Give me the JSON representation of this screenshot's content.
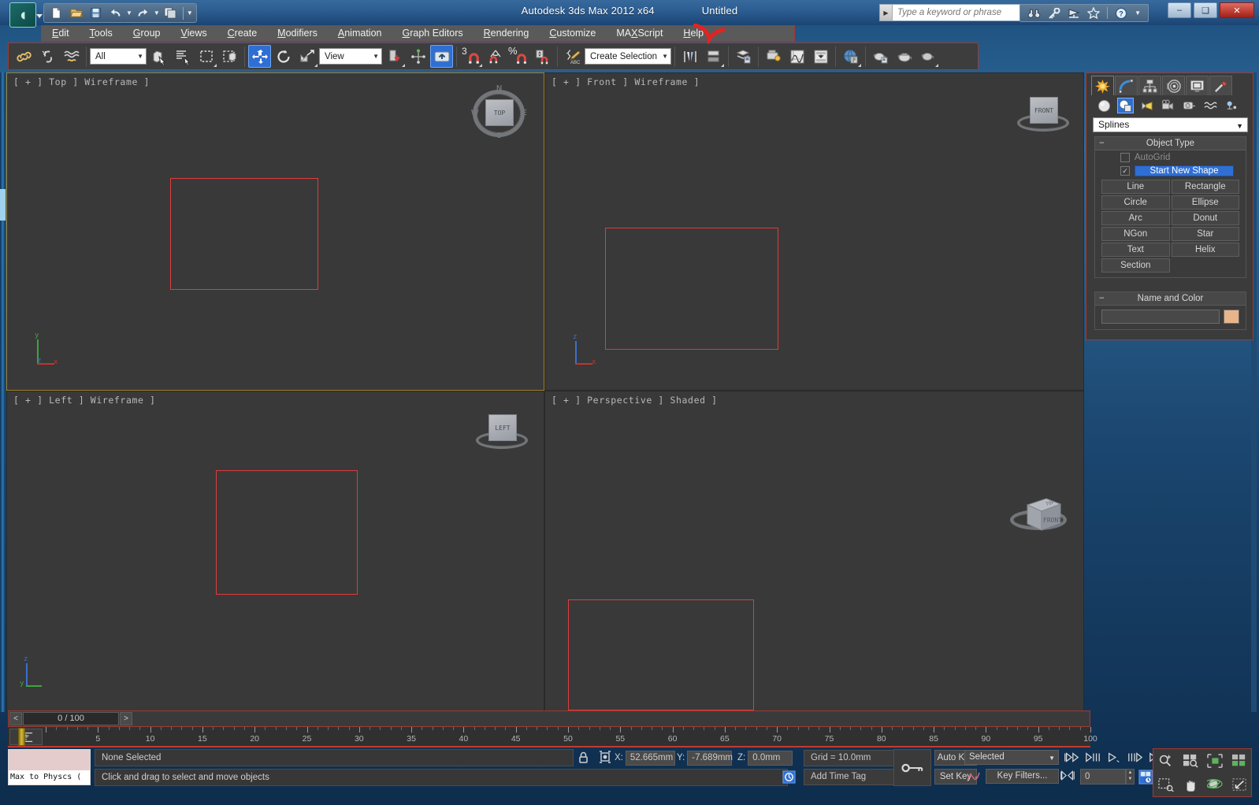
{
  "titlebar": {
    "app_title": "Autodesk 3ds Max  2012 x64",
    "document": "Untitled",
    "search_placeholder": "Type a keyword or phrase",
    "quick_access": [
      {
        "name": "new-file",
        "glyph": "⬜"
      },
      {
        "name": "open-file",
        "glyph": "📂"
      },
      {
        "name": "save-file",
        "glyph": "💾"
      },
      {
        "name": "undo",
        "glyph": "↶"
      },
      {
        "name": "redo",
        "glyph": "↷"
      },
      {
        "name": "project-folder",
        "glyph": "⧉"
      }
    ],
    "infocenter": [
      {
        "name": "search-binoculars-icon",
        "glyph": "🔍"
      },
      {
        "name": "subscription-key-icon",
        "glyph": "🔑"
      },
      {
        "name": "communication-center-icon",
        "glyph": "📡"
      },
      {
        "name": "favorites-star-icon",
        "glyph": "☆"
      },
      {
        "name": "help-icon",
        "glyph": "?"
      }
    ],
    "window_buttons": [
      {
        "name": "minimize-button",
        "glyph": "–"
      },
      {
        "name": "maximize-button",
        "glyph": "❑"
      },
      {
        "name": "close-button",
        "glyph": "✕"
      }
    ]
  },
  "menubar": {
    "items": [
      {
        "label": "Edit",
        "accel": "E"
      },
      {
        "label": "Tools",
        "accel": "T"
      },
      {
        "label": "Group",
        "accel": "G"
      },
      {
        "label": "Views",
        "accel": "V"
      },
      {
        "label": "Create",
        "accel": "C"
      },
      {
        "label": "Modifiers",
        "accel": "M"
      },
      {
        "label": "Animation",
        "accel": "A"
      },
      {
        "label": "Graph Editors",
        "accel": "G"
      },
      {
        "label": "Rendering",
        "accel": "R"
      },
      {
        "label": "Customize",
        "accel": "C"
      },
      {
        "label": "MAXScript",
        "accel": "X"
      },
      {
        "label": "Help",
        "accel": "H"
      }
    ]
  },
  "toolbar": {
    "selection_filter": "All",
    "reference_coord": "View",
    "named_selection_set": "Create Selection Set",
    "snap_percent_label": "3",
    "buttons": [
      {
        "name": "select-and-link-button",
        "icon": "link-icon"
      },
      {
        "name": "unlink-selection-button",
        "icon": "unlink-icon"
      },
      {
        "name": "bind-to-space-warp-button",
        "icon": "space-warp-icon"
      },
      {
        "name": "select-object-button",
        "icon": "select-cursor-icon"
      },
      {
        "name": "select-by-name-button",
        "icon": "select-by-name-icon"
      },
      {
        "name": "rectangular-selection-region-button",
        "icon": "rect-select-icon"
      },
      {
        "name": "window-crossing-button",
        "icon": "window-crossing-icon"
      },
      {
        "name": "select-and-move-button",
        "icon": "move-gizmo-icon"
      },
      {
        "name": "select-and-rotate-button",
        "icon": "rotate-gizmo-icon"
      },
      {
        "name": "select-and-scale-button",
        "icon": "scale-gizmo-icon"
      },
      {
        "name": "use-center-flyout-button",
        "icon": "pivot-center-icon"
      },
      {
        "name": "select-and-manipulate-button",
        "icon": "manipulate-icon"
      },
      {
        "name": "keyboard-shortcut-override-button",
        "icon": "keyboard-toggle-icon"
      },
      {
        "name": "snaps-toggle-button",
        "icon": "snap-magnet-icon"
      },
      {
        "name": "angle-snap-toggle-button",
        "icon": "angle-snap-icon"
      },
      {
        "name": "percent-snap-toggle-button",
        "icon": "percent-snap-icon"
      },
      {
        "name": "spinner-snap-toggle-button",
        "icon": "spinner-snap-icon"
      },
      {
        "name": "edit-named-selection-sets-button",
        "icon": "named-set-edit-icon"
      },
      {
        "name": "mirror-button",
        "icon": "mirror-icon"
      },
      {
        "name": "align-button",
        "icon": "align-icon"
      },
      {
        "name": "layer-manager-button",
        "icon": "layers-icon"
      },
      {
        "name": "render-setup-button",
        "icon": "render-setup-icon"
      },
      {
        "name": "curve-editor-button",
        "icon": "curve-editor-icon"
      },
      {
        "name": "schematic-view-button",
        "icon": "schematic-view-icon"
      },
      {
        "name": "material-editor-button",
        "icon": "material-editor-icon"
      },
      {
        "name": "render-production-button",
        "icon": "teapot-render-icon"
      },
      {
        "name": "render-iterative-button",
        "icon": "teapot-iterative-icon"
      },
      {
        "name": "activeshade-button",
        "icon": "teapot-activeshade-icon"
      }
    ]
  },
  "viewports": [
    {
      "name": "viewport-top",
      "label": "[ + ] Top ] Wireframe ]",
      "raw_label": "[ + ⎕ Top ⎕ Wireframe ]",
      "active": true,
      "shade": "Wireframe",
      "view": "Top",
      "shape_color": "#e03c3c",
      "viewcube_face": "TOP",
      "compass": [
        "N",
        "E",
        "S",
        "W"
      ]
    },
    {
      "name": "viewport-front",
      "label": "[ + ] Front ] Wireframe ]",
      "active": false,
      "shade": "Wireframe",
      "view": "Front",
      "shape_color": "#e03c3c",
      "viewcube_face": "FRONT"
    },
    {
      "name": "viewport-left",
      "label": "[ + ] Left ] Wireframe ]",
      "active": false,
      "shade": "Wireframe",
      "view": "Left",
      "shape_color": "#e03c3c",
      "viewcube_face": "LEFT"
    },
    {
      "name": "viewport-perspective",
      "label": "[ + ] Perspective ] Shaded ]",
      "active": false,
      "shade": "Shaded",
      "view": "Perspective",
      "shape_color": "#e03c3c",
      "viewcube_face": "FRONT"
    }
  ],
  "axis_gizmo": {
    "x": "x",
    "y": "y",
    "z": "z",
    "x_color": "#c1342f",
    "y_color": "#3fa33f",
    "z_color": "#3a6fd0"
  },
  "command_panel": {
    "tabs": [
      {
        "name": "create-tab",
        "icon": "star-burst-icon",
        "selected": true
      },
      {
        "name": "modify-tab",
        "icon": "arc-modify-icon",
        "selected": false
      },
      {
        "name": "hierarchy-tab",
        "icon": "hierarchy-icon",
        "selected": false
      },
      {
        "name": "motion-tab",
        "icon": "motion-wheel-icon",
        "selected": false
      },
      {
        "name": "display-tab",
        "icon": "display-monitor-icon",
        "selected": false
      },
      {
        "name": "utilities-tab",
        "icon": "hammer-icon",
        "selected": false
      }
    ],
    "categories": [
      {
        "name": "geometry-category",
        "icon": "sphere-icon",
        "selected": false
      },
      {
        "name": "shapes-category",
        "icon": "shapes-icon",
        "selected": true
      },
      {
        "name": "lights-category",
        "icon": "light-icon",
        "selected": false
      },
      {
        "name": "cameras-category",
        "icon": "camera-icon",
        "selected": false
      },
      {
        "name": "helpers-category",
        "icon": "tape-measure-icon",
        "selected": false
      },
      {
        "name": "space-warps-category",
        "icon": "wave-icon",
        "selected": false
      },
      {
        "name": "systems-category",
        "icon": "systems-icon",
        "selected": false
      }
    ],
    "subcategory": "Splines",
    "object_type_rollout": {
      "title": "Object Type",
      "autogrid_label": "AutoGrid",
      "autogrid_checked": false,
      "start_new_shape_label": "Start New Shape",
      "start_new_shape_checked": true,
      "buttons": [
        "Line",
        "Rectangle",
        "Circle",
        "Ellipse",
        "Arc",
        "Donut",
        "NGon",
        "Star",
        "Text",
        "Helix",
        "Section"
      ]
    },
    "name_and_color_rollout": {
      "title": "Name and Color",
      "name_value": "",
      "color": "#e8b58b"
    }
  },
  "timeline": {
    "frame_display": "0 / 100",
    "prev_glyph": "<",
    "next_glyph": ">",
    "ruler_labels": [
      5,
      10,
      15,
      20,
      25,
      30,
      35,
      40,
      45,
      50,
      55,
      60,
      65,
      70,
      75,
      80,
      85,
      90,
      95,
      100
    ],
    "range_start": 0,
    "range_end": 100,
    "current_frame": 0
  },
  "statusbar": {
    "mini_listener_text": "Max to Physcs (",
    "selection_status": "None Selected",
    "prompt_text": "Click and drag to select and move objects",
    "lock_icon": "lock-icon",
    "absolute_mode_icon": "absolute-relative-icon",
    "coords": [
      {
        "axis": "X:",
        "value": "52.665mm"
      },
      {
        "axis": "Y:",
        "value": "-7.689mm"
      },
      {
        "axis": "Z:",
        "value": "0.0mm"
      }
    ],
    "grid_text": "Grid = 10.0mm",
    "add_time_tag": "Add Time Tag",
    "auto_key_label": "Auto Key",
    "set_key_label": "Set Key",
    "key_mode_value": "Selected",
    "key_filters_label": "Key Filters...",
    "frame_field_value": "0",
    "playback_buttons": [
      {
        "name": "go-to-start-button",
        "glyph": "⏮"
      },
      {
        "name": "previous-frame-button",
        "glyph": "◁"
      },
      {
        "name": "play-animation-button",
        "glyph": "▷"
      },
      {
        "name": "next-frame-button",
        "glyph": "▷"
      },
      {
        "name": "go-to-end-button",
        "glyph": "⏭"
      }
    ],
    "nav_buttons": [
      {
        "name": "zoom-button",
        "glyph": "🔍"
      },
      {
        "name": "zoom-all-button",
        "glyph": "⊞"
      },
      {
        "name": "zoom-extents-button",
        "glyph": "◱"
      },
      {
        "name": "zoom-extents-all-button",
        "glyph": "◰"
      },
      {
        "name": "field-of-view-button",
        "glyph": "⬚"
      },
      {
        "name": "pan-view-button",
        "glyph": "✋"
      },
      {
        "name": "orbit-button",
        "glyph": "◔"
      },
      {
        "name": "maximize-viewport-toggle-button",
        "glyph": "⤡"
      }
    ]
  }
}
